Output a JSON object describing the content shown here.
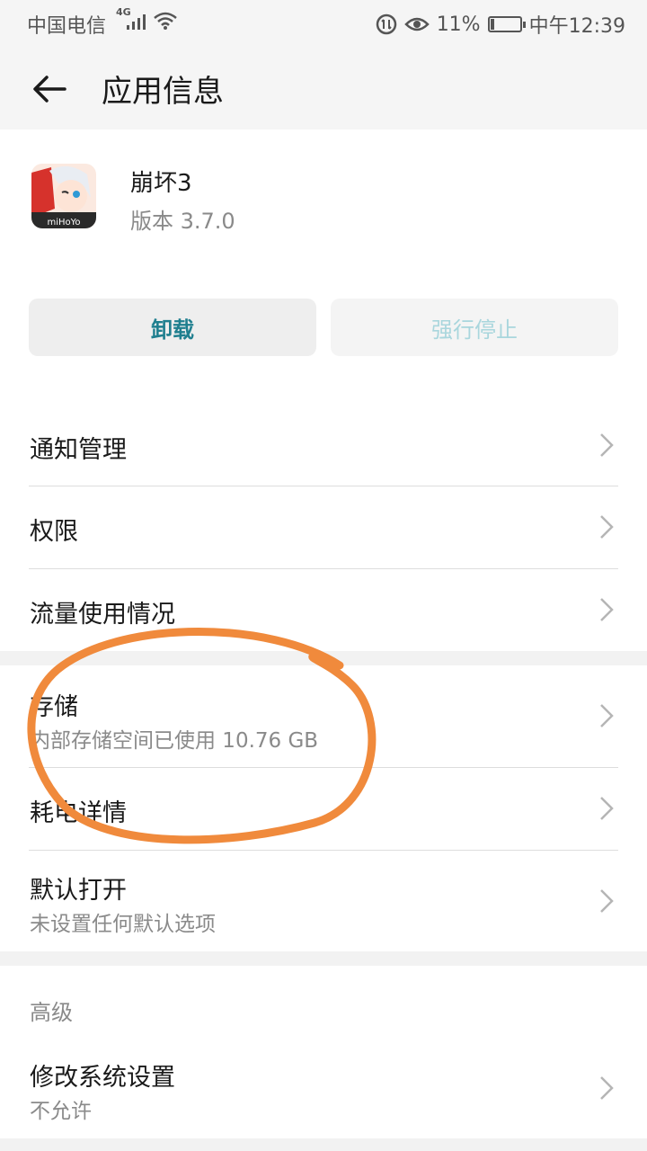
{
  "status_bar": {
    "carrier": "中国电信",
    "network": "4G",
    "battery": "11%",
    "battery_level": 0.11,
    "time": "中午12:39"
  },
  "header": {
    "title": "应用信息"
  },
  "app": {
    "name": "崩坏3",
    "version": "版本 3.7.0",
    "icon_text": "miHoYo"
  },
  "buttons": {
    "uninstall": "卸载",
    "force_stop": "强行停止"
  },
  "list": [
    {
      "title": "通知管理"
    },
    {
      "title": "权限"
    },
    {
      "title": "流量使用情况"
    },
    {
      "title": "存储",
      "subtitle": "内部存储空间已使用 10.76 GB"
    },
    {
      "title": "耗电详情"
    },
    {
      "title": "默认打开",
      "subtitle": "未设置任何默认选项"
    }
  ],
  "advanced": {
    "section_label": "高级",
    "item": {
      "title": "修改系统设置",
      "subtitle": "不允许"
    }
  },
  "colors": {
    "accent": "#1f7f8f",
    "annotation": "#f08a3c"
  }
}
